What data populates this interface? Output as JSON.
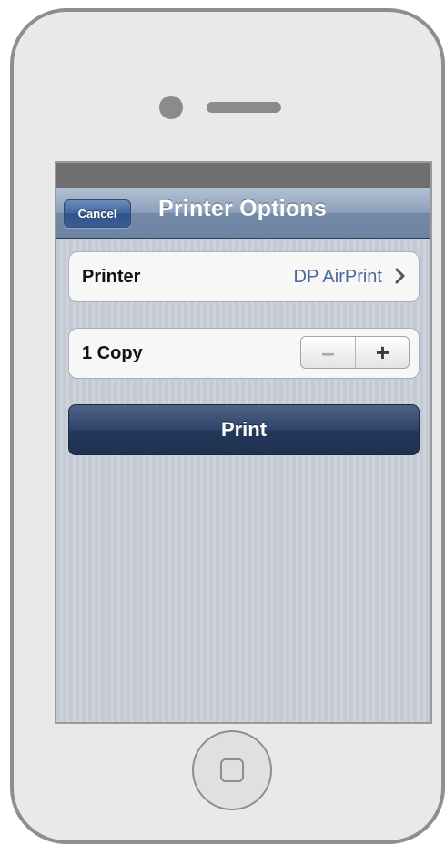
{
  "navbar": {
    "cancel_label": "Cancel",
    "title": "Printer Options"
  },
  "printer_cell": {
    "label": "Printer",
    "value": "DP AirPrint",
    "accessory": "chevron-right-icon"
  },
  "copies_cell": {
    "label": "1 Copy",
    "decrement_label": "–",
    "increment_label": "+"
  },
  "print_button": {
    "label": "Print"
  },
  "colors": {
    "nav_bar": "#7389a7",
    "print_button": "#2f4468",
    "value_text": "#4a6a9a",
    "background": "#c6ccd6"
  }
}
